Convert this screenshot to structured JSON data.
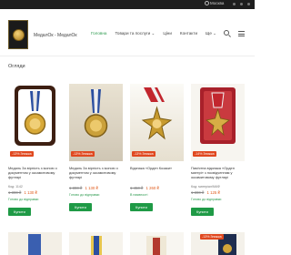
{
  "browser": {
    "location_text": "Москва"
  },
  "header": {
    "brand": "МедалОк - МедалОк",
    "nav": [
      {
        "label": "Головна",
        "active": true
      },
      {
        "label": "Товари та послуги ⌄",
        "active": false
      },
      {
        "label": "Ціни",
        "active": false
      },
      {
        "label": "Контакти",
        "active": false
      },
      {
        "label": "Ще ⌄",
        "active": false
      }
    ]
  },
  "section": {
    "title": "Огляди"
  },
  "products": [
    {
      "badge": "-13% Знижка",
      "title": "Медаль За вірність з іконою о документом у оксамитовому футлярі",
      "code": "Код: 1142",
      "old_price": "1 300 ₴",
      "new_price": "1 130 ₴",
      "availability": "Готово до відправки",
      "buy": "Купити"
    },
    {
      "badge": "-13% Знижка",
      "title": "Медаль За вірність з іконою о документом у оксамитовому футлярі",
      "code": "",
      "old_price": "1 300 ₴",
      "new_price": "1 130 ₴",
      "availability": "Готово до відправки",
      "buy": "Купити"
    },
    {
      "badge": "-13% Знижка",
      "title": "Відзнака «Орден Козаки»",
      "code": "",
      "old_price": "1 450 ₴",
      "new_price": "1 260 ₴",
      "availability": "В наявності",
      "buy": "Купити"
    },
    {
      "badge": "-14% Знижка",
      "title": "Пам'ятна відзнака «Орден матері» з посвідченням у оксамитовому футлярі",
      "code": "Код: матеріал/МАФ",
      "old_price": "1 300 ₴",
      "new_price": "1 125 ₴",
      "availability": "Готово до відправки",
      "buy": "Купити"
    }
  ],
  "bottom_row": [
    {
      "badge": ""
    },
    {
      "badge": ""
    },
    {
      "badge": ""
    },
    {
      "badge": "-13% Знижка"
    }
  ]
}
